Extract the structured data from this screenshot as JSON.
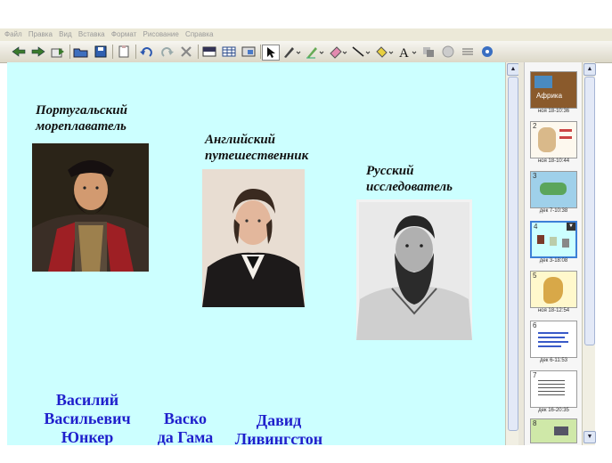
{
  "menu": [
    "Файл",
    "Правка",
    "Вид",
    "Вставка",
    "Формат",
    "Рисование",
    "Справка"
  ],
  "toolbar_icons": [
    "back-icon",
    "forward-icon",
    "add-page-icon",
    "open-icon",
    "save-icon",
    "paste-icon",
    "undo-icon",
    "redo-icon",
    "delete-icon",
    "screen-shade-icon",
    "table-icon",
    "capture-icon",
    "select-arrow-icon",
    "pen-icon",
    "creative-pen-icon",
    "eraser-icon",
    "line-icon",
    "fill-icon",
    "text-icon",
    "properties-icon",
    "camera-icon",
    "more-icon",
    "settings-icon"
  ],
  "slide": {
    "captions": [
      {
        "line1": "Португальский",
        "line2": "мореплаватель"
      },
      {
        "line1": "Английский",
        "line2": "путешественник"
      },
      {
        "line1": "Русский",
        "line2": "исследователь"
      }
    ],
    "names": [
      {
        "line1": "Василий",
        "line2": "Васильевич",
        "line3": "Юнкер"
      },
      {
        "line1": "Васко",
        "line2": "да Гама"
      },
      {
        "line1": "Давид",
        "line2": "Ливингстон"
      }
    ]
  },
  "thumbnails": [
    {
      "num": "",
      "date": "ноя 18-10:36",
      "label": "Африка"
    },
    {
      "num": "2",
      "date": "ноя 18-10:44"
    },
    {
      "num": "3",
      "date": "дек 7-10:38"
    },
    {
      "num": "4",
      "date": "дек 3-18:08",
      "selected": true
    },
    {
      "num": "5",
      "date": "ноя 18-12:54"
    },
    {
      "num": "6",
      "date": "дек 6-11:53"
    },
    {
      "num": "7",
      "date": "дек 16-20:35"
    },
    {
      "num": "8",
      "date": ""
    }
  ]
}
